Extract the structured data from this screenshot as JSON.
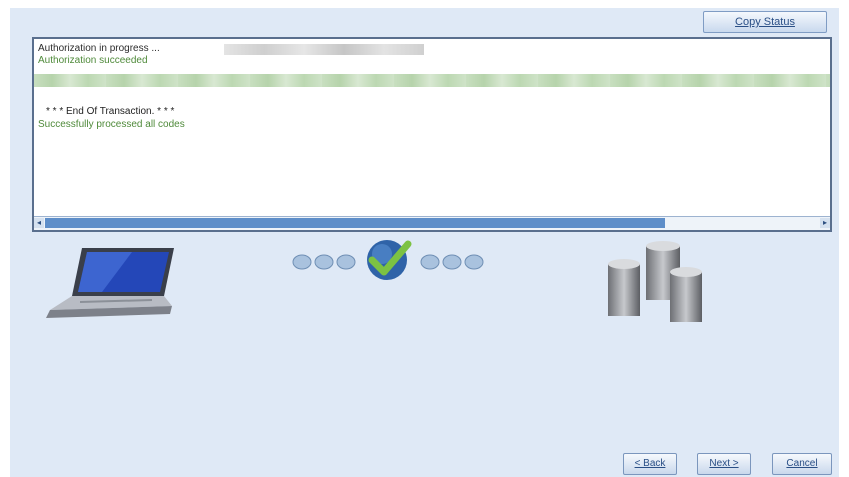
{
  "toolbar": {
    "copy_status_label": "Copy Status"
  },
  "log": {
    "line1": "Authorization in progress ...",
    "line2": "Authorization succeeded",
    "line3": "* * * End Of Transaction. * * *",
    "line4": "Successfully processed all codes"
  },
  "icons": {
    "client": "laptop-icon",
    "progress": "checkmark-progress-icon",
    "server": "database-servers-icon"
  },
  "progress": {
    "steps_before": 3,
    "steps_after": 3,
    "status": "complete"
  },
  "buttons": {
    "back": "< Back",
    "next": "Next >",
    "cancel": "Cancel"
  },
  "colors": {
    "panel_bg": "#dfe9f6",
    "success_text": "#4f8a3a",
    "accent": "#5e8ec9"
  }
}
